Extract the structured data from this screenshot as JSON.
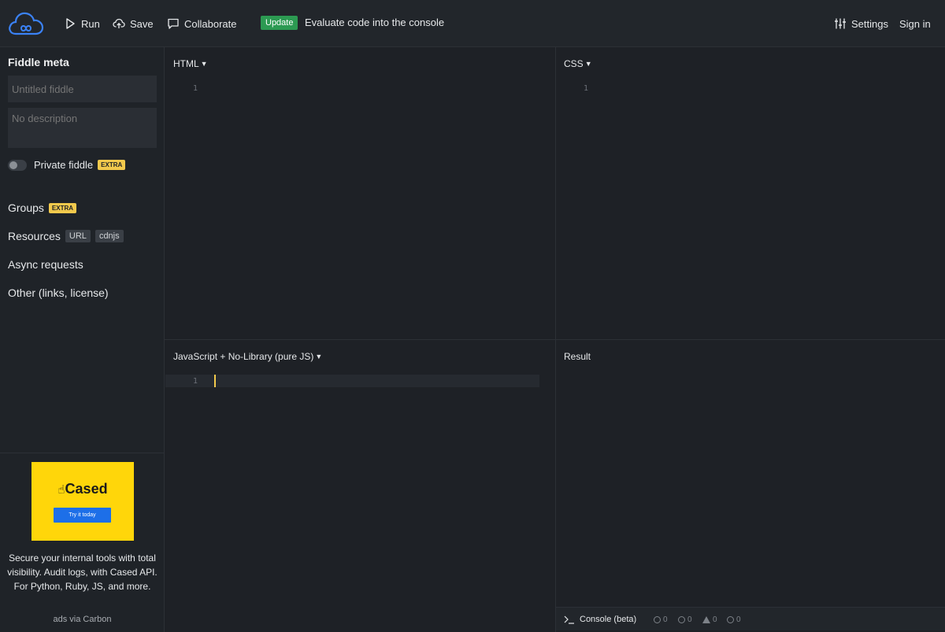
{
  "topbar": {
    "run_label": "Run",
    "save_label": "Save",
    "collaborate_label": "Collaborate",
    "update_badge": "Update",
    "update_text": "Evaluate code into the console",
    "settings_label": "Settings",
    "signin_label": "Sign in"
  },
  "sidebar": {
    "title": "Fiddle meta",
    "title_placeholder": "Untitled fiddle",
    "description_placeholder": "No description",
    "private_label": "Private fiddle",
    "extra_badge": "EXTRA",
    "groups_label": "Groups",
    "resources_label": "Resources",
    "resources_chips": [
      "URL",
      "cdnjs"
    ],
    "async_label": "Async requests",
    "other_label": "Other (links, license)"
  },
  "ad": {
    "brand": "Cased",
    "cta": "Try it today",
    "text": "Secure your internal tools with total visibility. Audit logs, with Cased API. For Python, Ruby, JS, and more.",
    "via": "ads via Carbon"
  },
  "panels": {
    "html_title": "HTML",
    "css_title": "CSS",
    "js_title": "JavaScript + No-Library (pure JS)",
    "result_title": "Result",
    "line_number": "1"
  },
  "console": {
    "label": "Console (beta)",
    "counts": [
      "0",
      "0",
      "0",
      "0"
    ]
  },
  "colors": {
    "accent_update": "#2c9a52",
    "extra_badge": "#f2c94c",
    "logo_blue": "#3b82f6",
    "ad_yellow": "#ffd60a",
    "ad_button": "#1d6fe8"
  }
}
